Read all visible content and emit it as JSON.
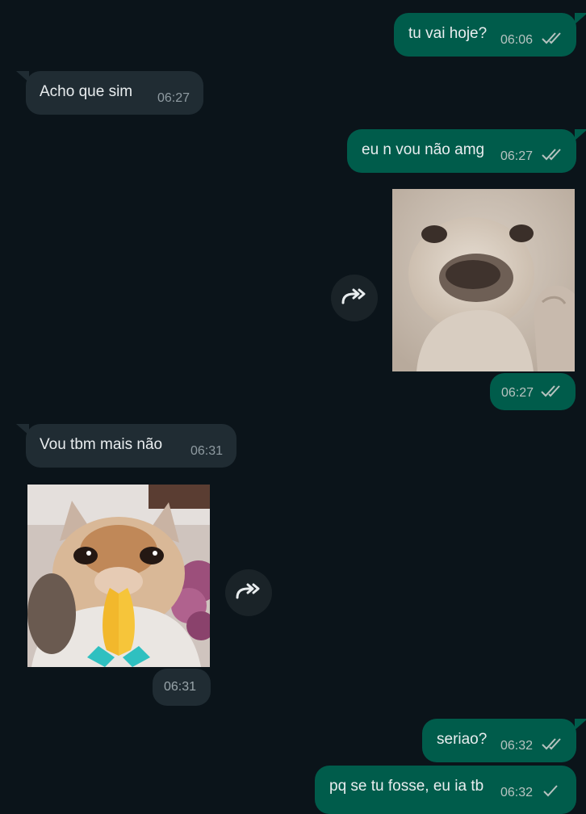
{
  "messages": [
    {
      "direction": "out",
      "text": "tu vai hoje?",
      "time": "06:06",
      "status": "read"
    },
    {
      "direction": "in",
      "text": "Acho que sim",
      "time": "06:27"
    },
    {
      "direction": "out",
      "text": "eu n vou não amg",
      "time": "06:27",
      "status": "read"
    },
    {
      "direction": "out",
      "type": "sticker",
      "sticker_icon": "dog-face-sticker",
      "time": "06:27",
      "status": "read",
      "forward_icon": "forward-icon"
    },
    {
      "direction": "in",
      "text": "Vou tbm mais não",
      "time": "06:31"
    },
    {
      "direction": "in",
      "type": "sticker",
      "sticker_icon": "cat-praying-hands-sticker",
      "time": "06:31",
      "forward_icon": "forward-icon"
    },
    {
      "direction": "out",
      "text": "seriao?",
      "time": "06:32",
      "status": "read"
    },
    {
      "direction": "out",
      "text": "pq se tu fosse, eu ia tb",
      "time": "06:32",
      "status": "sent"
    }
  ],
  "colors": {
    "background": "#0b141a",
    "outgoing_bubble": "#005c4b",
    "incoming_bubble": "#202c33",
    "text": "#e9edef",
    "timestamp": "#b7c3c0",
    "tick_read": "#b7c3c0"
  }
}
